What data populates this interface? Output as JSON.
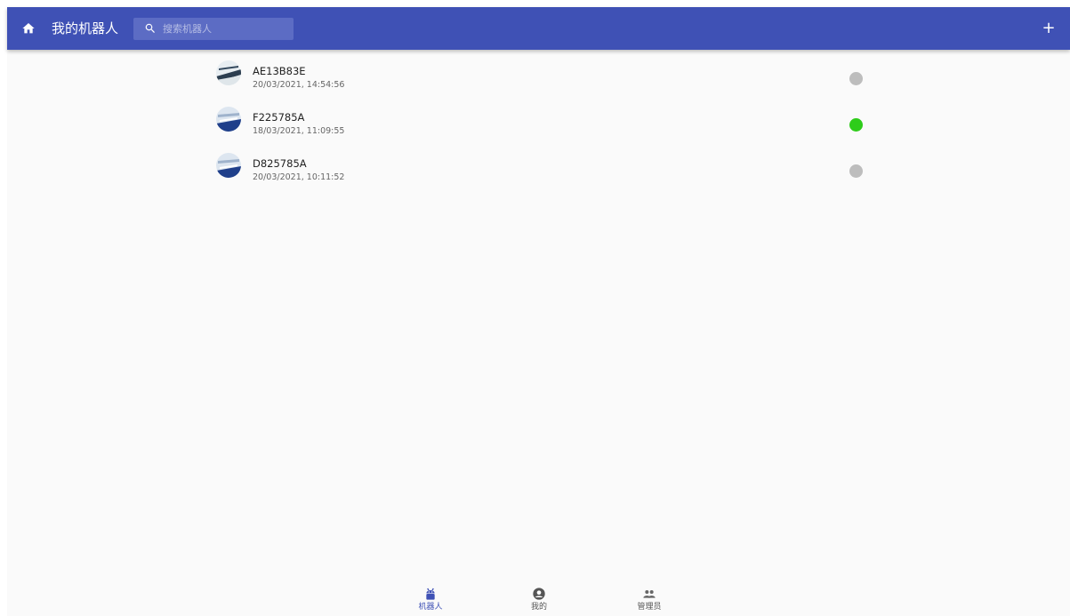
{
  "app": {
    "title": "我的机器人",
    "accent": "#3f51b5"
  },
  "search": {
    "placeholder": "搜索机器人",
    "value": ""
  },
  "toolbar": {
    "add_label": "+"
  },
  "robots": [
    {
      "name": "AE13B83E",
      "time": "20/03/2021, 14:54:56",
      "online": false
    },
    {
      "name": "F225785A",
      "time": "18/03/2021, 11:09:55",
      "online": true
    },
    {
      "name": "D825785A",
      "time": "20/03/2021, 10:11:52",
      "online": false
    }
  ],
  "status_colors": {
    "online": "#2ecc1a",
    "offline": "#bdbdbd"
  },
  "bottom_nav": [
    {
      "label": "机器人",
      "icon": "robot-icon",
      "active": true
    },
    {
      "label": "我的",
      "icon": "account-circle-icon",
      "active": false
    },
    {
      "label": "管理员",
      "icon": "group-icon",
      "active": false
    }
  ]
}
